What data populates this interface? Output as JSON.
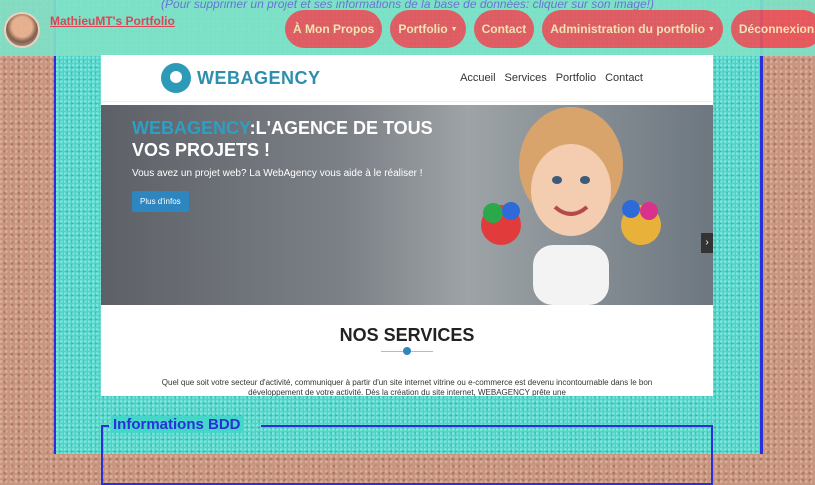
{
  "notice": "(Pour supprimer un projet et ses informations de la base de données: cliquer sur son image!)",
  "brand": "MathieuMT's Portfolio",
  "nav": [
    {
      "label": "À Mon Propos",
      "has_dropdown": false
    },
    {
      "label": "Portfolio",
      "has_dropdown": true
    },
    {
      "label": "Contact",
      "has_dropdown": false
    },
    {
      "label": "Administration du portfolio",
      "has_dropdown": true
    },
    {
      "label": "Déconnexion",
      "has_dropdown": false
    }
  ],
  "preview": {
    "logo_text": "WEBAGENCY",
    "menu": [
      "Accueil",
      "Services",
      "Portfolio",
      "Contact"
    ],
    "hero": {
      "title_accent": "WEBAGENCY",
      "title_rest": ":L'AGENCE DE TOUS",
      "title_line2": "VOS PROJETS !",
      "subtitle": "Vous avez un projet web? La WebAgency vous aide à le réaliser !",
      "button": "Plus d'infos",
      "next": "›"
    },
    "services_title": "NOS SERVICES",
    "services_text": "Quel que soit votre secteur d'activité, communiquer à partir d'un site internet vitrine ou e-commerce est devenu incontournable dans le bon développement de votre activité. Dès la création du site internet, WEBAGENCY prête une"
  },
  "bdd_legend": "Informations BDD",
  "colors": {
    "accent": "#e9545c",
    "pill_text": "#fbe6b2",
    "turquoise": "#43d6c9",
    "border_blue": "#2a2fd9",
    "brand_blue": "#2d8fae"
  }
}
